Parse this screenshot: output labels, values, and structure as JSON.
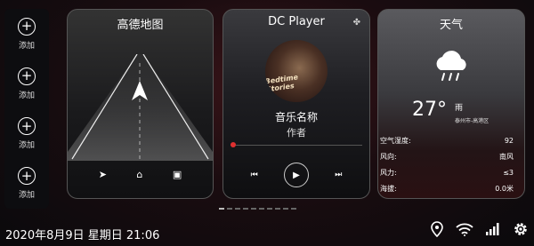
{
  "sidebar": {
    "slots": [
      {
        "label": "添加"
      },
      {
        "label": "添加"
      },
      {
        "label": "添加"
      },
      {
        "label": "添加"
      }
    ]
  },
  "map_card": {
    "title": "高德地图",
    "icons": [
      "navigate-icon",
      "home-icon",
      "briefcase-icon"
    ]
  },
  "player_card": {
    "title": "DC Player",
    "cover_text": "Bedtime Stories",
    "song": "音乐名称",
    "artist": "作者",
    "progress_percent": 2,
    "controls": {
      "prev": "⏮",
      "play": "▶",
      "next": "⏭"
    }
  },
  "weather_card": {
    "title": "天气",
    "icon": "rain-cloud-icon",
    "temperature": "27°",
    "condition": "雨",
    "location": "泰州市-高港区",
    "rows": [
      {
        "label": "空气湿度:",
        "value": "92"
      },
      {
        "label": "风向:",
        "value": "南风"
      },
      {
        "label": "风力:",
        "value": "≤3"
      },
      {
        "label": "海拔:",
        "value": "0.0米"
      }
    ]
  },
  "pager": {
    "count": 10,
    "active_index": 0
  },
  "status_bar": {
    "datetime": "2020年8月9日  星期日  21:06",
    "icons": [
      "location-icon",
      "wifi-icon",
      "signal-icon",
      "settings-icon"
    ]
  },
  "colors": {
    "accent": "#e03030",
    "background": "#0a0a0c"
  }
}
